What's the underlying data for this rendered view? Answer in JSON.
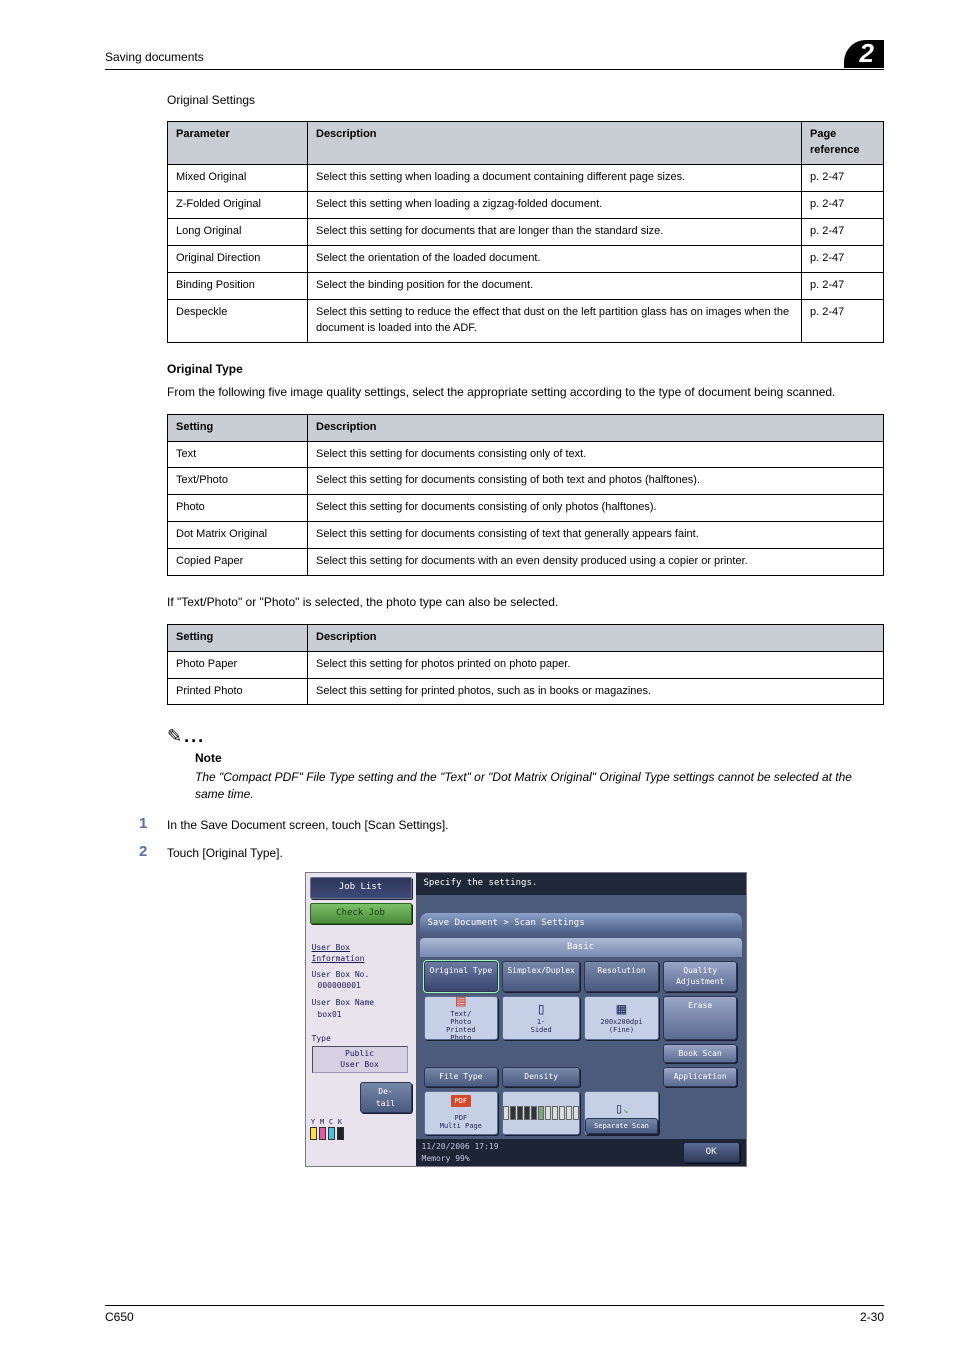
{
  "header": {
    "section": "Saving documents",
    "chapter": "2"
  },
  "title1": "Original Settings",
  "table1": {
    "headers": [
      "Parameter",
      "Description",
      "Page reference"
    ],
    "rows": [
      {
        "p": "Mixed Original",
        "d": "Select this setting when loading a document containing different page sizes.",
        "r": "p. 2-47"
      },
      {
        "p": "Z-Folded Original",
        "d": "Select this setting when loading a zigzag-folded document.",
        "r": "p. 2-47"
      },
      {
        "p": "Long Original",
        "d": "Select this setting for documents that are longer than the standard size.",
        "r": "p. 2-47"
      },
      {
        "p": "Original Direction",
        "d": "Select the orientation of the loaded document.",
        "r": "p. 2-47"
      },
      {
        "p": "Binding Position",
        "d": "Select the binding position for the document.",
        "r": "p. 2-47"
      },
      {
        "p": "Despeckle",
        "d": "Select this setting to reduce the effect that dust on the left partition glass has on images when the document is loaded into the ADF.",
        "r": "p. 2-47"
      }
    ]
  },
  "sec2": {
    "title": "Original Type",
    "intro": "From the following five image quality settings, select the appropriate setting according to the type of document being scanned."
  },
  "table2": {
    "headers": [
      "Setting",
      "Description"
    ],
    "rows": [
      {
        "p": "Text",
        "d": "Select this setting for documents consisting only of text."
      },
      {
        "p": "Text/Photo",
        "d": "Select this setting for documents consisting of both text and photos (halftones)."
      },
      {
        "p": "Photo",
        "d": "Select this setting for documents consisting of only photos (halftones)."
      },
      {
        "p": "Dot Matrix Original",
        "d": "Select this setting for documents consisting of text that generally appears faint."
      },
      {
        "p": "Copied Paper",
        "d": "Select this setting for documents with an even density produced using a copier or printer."
      }
    ]
  },
  "between": "If \"Text/Photo\" or \"Photo\" is selected, the photo type can also be selected.",
  "table3": {
    "headers": [
      "Setting",
      "Description"
    ],
    "rows": [
      {
        "p": "Photo Paper",
        "d": "Select this setting for photos printed on photo paper."
      },
      {
        "p": "Printed Photo",
        "d": "Select this setting for printed photos, such as in books or magazines."
      }
    ]
  },
  "note": {
    "title": "Note",
    "body": "The \"Compact PDF\" File Type setting and the \"Text\" or \"Dot Matrix Original\" Original Type settings cannot be selected at the same time."
  },
  "steps": {
    "s1": {
      "n": "1",
      "t": "In the Save Document screen, touch [Scan Settings]."
    },
    "s2": {
      "n": "2",
      "t": "Touch [Original Type]."
    }
  },
  "ui": {
    "jobList": "Job List",
    "checkJob": "Check Job",
    "userBoxInfo": "User Box\nInformation",
    "userBoxNoLabel": "User Box No.",
    "userBoxNo": "000000001",
    "userBoxNameLabel": "User Box Name",
    "userBoxName": "box01",
    "typeLabel": "Type",
    "typeVal": "Public\nUser Box",
    "detail": "De-\ntail",
    "headline": "Specify the settings.",
    "breadcrumb": "Save Document > Scan Settings",
    "tabBasic": "Basic",
    "btns": {
      "origType": "Original Type",
      "simplex": "Simplex/Duplex",
      "resolution": "Resolution",
      "quality": "Quality\nAdjustment",
      "erase": "Erase",
      "book": "Book Scan",
      "app": "Application",
      "fileType": "File Type",
      "density": "Density",
      "sepScan": "Separate Scan",
      "ok": "OK"
    },
    "tiles": {
      "origType": "Text/\nPhoto\nPrinted\nPhoto",
      "simplex": "1-\nSided",
      "resolution": "200x200dpi\n(Fine)",
      "fileTypeTop": "PDF",
      "fileTypeBot": "PDF\nMulti Page"
    },
    "datetime": "11/20/2006   17:19",
    "memory": "Memory        99%",
    "toner": {
      "y": "Y",
      "m": "M",
      "c": "C",
      "k": "K"
    }
  },
  "footer": {
    "left": "C650",
    "right": "2-30"
  }
}
